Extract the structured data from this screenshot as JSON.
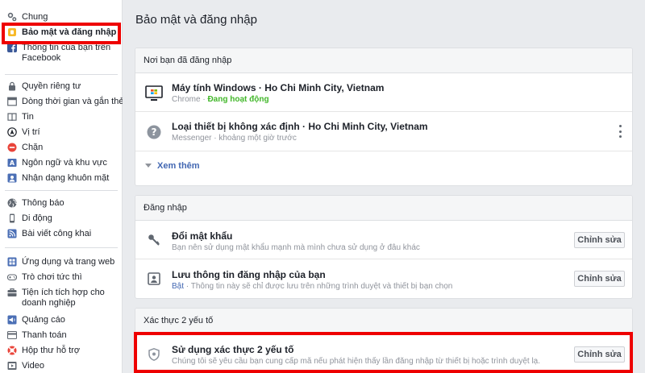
{
  "sidebar": {
    "group1": [
      {
        "label": "Chung",
        "icon": "gear-icon"
      },
      {
        "label": "Bảo mật và đăng nhập",
        "icon": "shield-icon"
      },
      {
        "label": "Thông tin của bạn trên Facebook",
        "icon": "facebook-icon"
      }
    ],
    "group2": [
      {
        "label": "Quyền riêng tư",
        "icon": "lock-icon"
      },
      {
        "label": "Dòng thời gian và gắn thẻ",
        "icon": "timeline-icon"
      },
      {
        "label": "Tin",
        "icon": "book-icon"
      },
      {
        "label": "Vị trí",
        "icon": "location-icon"
      },
      {
        "label": "Chặn",
        "icon": "block-icon"
      },
      {
        "label": "Ngôn ngữ và khu vực",
        "icon": "language-icon"
      },
      {
        "label": "Nhận dạng khuôn mặt",
        "icon": "face-recognition-icon"
      }
    ],
    "group3": [
      {
        "label": "Thông báo",
        "icon": "globe-icon"
      },
      {
        "label": "Di động",
        "icon": "mobile-icon"
      },
      {
        "label": "Bài viết công khai",
        "icon": "rss-icon"
      }
    ],
    "group4": [
      {
        "label": "Ứng dụng và trang web",
        "icon": "apps-icon"
      },
      {
        "label": "Trò chơi tức thì",
        "icon": "gamepad-icon"
      },
      {
        "label": "Tiện ích tích hợp cho doanh nghiệp",
        "icon": "business-icon"
      },
      {
        "label": "Quảng cáo",
        "icon": "ads-icon"
      },
      {
        "label": "Thanh toán",
        "icon": "payment-icon"
      },
      {
        "label": "Hộp thư hỗ trợ",
        "icon": "lifebuoy-icon"
      },
      {
        "label": "Video",
        "icon": "video-icon"
      }
    ]
  },
  "main": {
    "title": "Bảo mật và đăng nhập",
    "where_logged_in": {
      "header": "Nơi bạn đã đăng nhập",
      "sessions": [
        {
          "device": "Máy tính Windows · Ho Chi Minh City, Vietnam",
          "app": "Chrome · ",
          "status": "Đang hoạt động",
          "icon": "windows-computer-icon"
        },
        {
          "device": "Loại thiết bị không xác định · Ho Chi Minh City, Vietnam",
          "detail": "Messenger · khoảng một giờ trước",
          "icon": "unknown-device-icon"
        }
      ],
      "see_more": "Xem thêm"
    },
    "login": {
      "header": "Đăng nhập",
      "rows": [
        {
          "title": "Đổi mật khẩu",
          "desc": "Bạn nên sử dụng mật khẩu mạnh mà mình chưa sử dụng ở đâu khác",
          "button": "Chỉnh sửa",
          "icon": "key-icon"
        },
        {
          "title": "Lưu thông tin đăng nhập của bạn",
          "status": "Bật",
          "desc": " · Thông tin này sẽ chỉ được lưu trên những trình duyệt và thiết bị bạn chọn",
          "button": "Chỉnh sửa",
          "icon": "saved-login-icon"
        }
      ]
    },
    "two_factor": {
      "header": "Xác thực 2 yếu tố",
      "title": "Sử dụng xác thực 2 yếu tố",
      "desc": "Chúng tôi sẽ yêu cầu bạn cung cấp mã nếu phát hiện thấy lần đăng nhập từ thiết bị hoặc trình duyệt lạ.",
      "button": "Chỉnh sửa",
      "icon": "shield-icon"
    }
  },
  "colors": {
    "highlight": "#ee0000",
    "link": "#4267b2",
    "active_green": "#42b72a",
    "background": "#e9ebee"
  }
}
